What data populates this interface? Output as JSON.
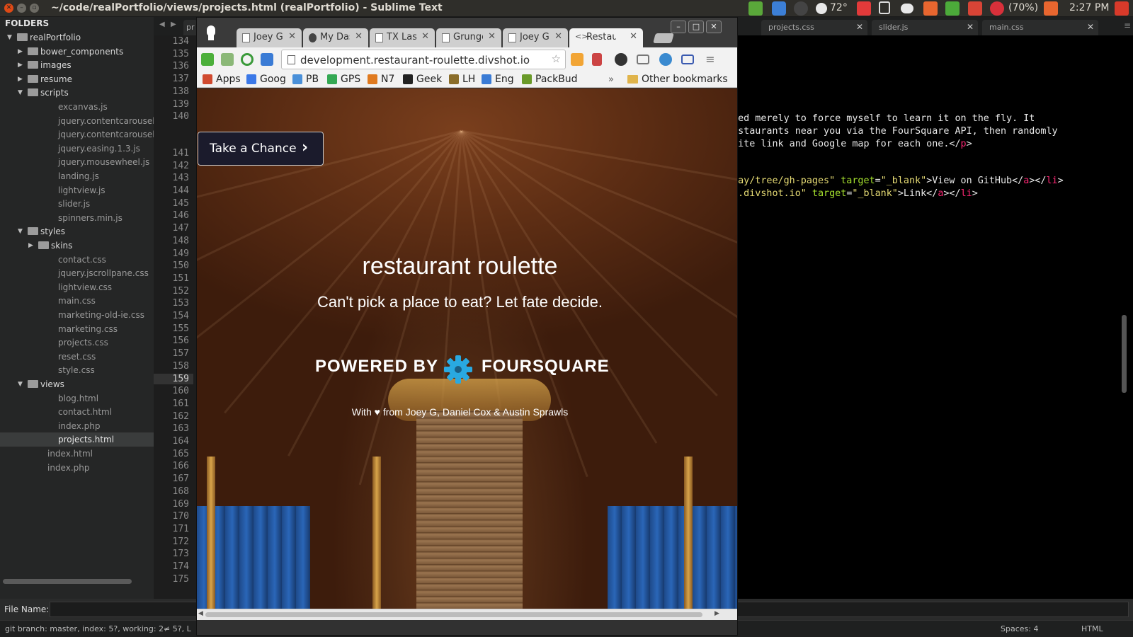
{
  "system": {
    "window_title": "~/code/realPortfolio/views/projects.html (realPortfolio) - Sublime Text",
    "temperature": "72°",
    "battery": "(70%)",
    "clock": "2:27 PM",
    "tray_icons": [
      "evernote-icon",
      "dropbox-icon",
      "moon-icon",
      "weather-icon",
      "x-icon",
      "copy-icon",
      "toggle-icon",
      "wifi-icon",
      "bluetooth-icon",
      "mail-icon",
      "block-icon",
      "battery-icon",
      "volume-icon",
      "gear-icon"
    ]
  },
  "sidebar": {
    "title": "FOLDERS",
    "items": [
      {
        "label": "realPortfolio"
      },
      {
        "label": "bower_components"
      },
      {
        "label": "images"
      },
      {
        "label": "resume"
      },
      {
        "label": "scripts"
      },
      {
        "label": "excanvas.js"
      },
      {
        "label": "jquery.contentcarousel.js"
      },
      {
        "label": "jquery.contentcarousel.js."
      },
      {
        "label": "jquery.easing.1.3.js"
      },
      {
        "label": "jquery.mousewheel.js"
      },
      {
        "label": "landing.js"
      },
      {
        "label": "lightview.js"
      },
      {
        "label": "slider.js"
      },
      {
        "label": "spinners.min.js"
      },
      {
        "label": "styles"
      },
      {
        "label": "skins"
      },
      {
        "label": "contact.css"
      },
      {
        "label": "jquery.jscrollpane.css"
      },
      {
        "label": "lightview.css"
      },
      {
        "label": "main.css"
      },
      {
        "label": "marketing-old-ie.css"
      },
      {
        "label": "marketing.css"
      },
      {
        "label": "projects.css"
      },
      {
        "label": "reset.css"
      },
      {
        "label": "style.css"
      },
      {
        "label": "views"
      },
      {
        "label": "blog.html"
      },
      {
        "label": "contact.html"
      },
      {
        "label": "index.php"
      },
      {
        "label": "projects.html"
      },
      {
        "label": "index.html"
      },
      {
        "label": "index.php"
      }
    ]
  },
  "editor": {
    "tabs": [
      {
        "label": "pr"
      },
      {
        "label": "projects.css"
      },
      {
        "label": "slider.js"
      },
      {
        "label": "main.css"
      }
    ],
    "line_numbers": [
      "134",
      "135",
      "136",
      "137",
      "138",
      "139",
      "140",
      "141",
      "142",
      "143",
      "144",
      "145",
      "146",
      "147",
      "148",
      "149",
      "150",
      "151",
      "152",
      "153",
      "154",
      "155",
      "156",
      "157",
      "158",
      "159",
      "160",
      "161",
      "162",
      "163",
      "164",
      "165",
      "166",
      "167",
      "168",
      "169",
      "170",
      "171",
      "172",
      "173",
      "174",
      "175"
    ],
    "current_line": "159",
    "code": {
      "l1": "used merely to force myself to learn it on the fly. It",
      "l2": "restaurants near you via the FourSquare API, then randomly",
      "l3a": "bsite link and Google map for each one.</",
      "l3b": "p",
      "l3c": ">",
      "l4a": "kday/tree/gh-pages\"",
      "l4b": " target",
      "l4c": "=",
      "l4d": "\"_blank\"",
      "l4e": ">View on GitHub</",
      "l4f": "a",
      "l4g": "></",
      "l4h": "li",
      "l4i": ">",
      "l5a": "te.divshot.io\"",
      "l5b": " target",
      "l5c": "=",
      "l5d": "\"_blank\"",
      "l5e": ">Link</",
      "l5f": "a",
      "l5g": "></",
      "l5h": "li",
      "l5i": ">",
      "l6": "\""
    }
  },
  "bottom": {
    "file_name_label": "File Name:",
    "status_left": "git branch: master, index: 5?, working: 2≠ 5?, L",
    "spaces": "Spaces: 4",
    "syntax": "HTML"
  },
  "browser": {
    "tabs": [
      {
        "label": "Joey G"
      },
      {
        "label": "My Das"
      },
      {
        "label": "TX Lass"
      },
      {
        "label": "Grunge"
      },
      {
        "label": "Joey G"
      },
      {
        "label": "Restau"
      }
    ],
    "url": "development.restaurant-roulette.divshot.io",
    "bookmarks": [
      {
        "label": "Apps",
        "color": "#d04a2f"
      },
      {
        "label": "Goog",
        "color": "#3b78e7"
      },
      {
        "label": "PB",
        "color": "#4a90d9"
      },
      {
        "label": "GPS",
        "color": "#34a853"
      },
      {
        "label": "N7",
        "color": "#e07a1f"
      },
      {
        "label": "Geek",
        "color": "#222222"
      },
      {
        "label": "LH",
        "color": "#8a6d2a"
      },
      {
        "label": "Eng",
        "color": "#3a7bd5"
      },
      {
        "label": "PackBud",
        "color": "#6a9a2a"
      }
    ],
    "bookmarks_more": "»",
    "other_bookmarks": "Other bookmarks"
  },
  "page": {
    "cta": "Take a Chance",
    "title": "restaurant roulette",
    "subtitle": "Can't pick a place to eat? Let fate decide.",
    "powered_by": "POWERED BY",
    "powered_name": "FOURSQUARE",
    "credits": "With ♥ from Joey G, Daniel Cox & Austin Sprawls"
  },
  "colors": {
    "foursquare_blue": "#29a9e1",
    "sublime_sidebar": "#252626",
    "monokai_string": "#e6db74"
  }
}
